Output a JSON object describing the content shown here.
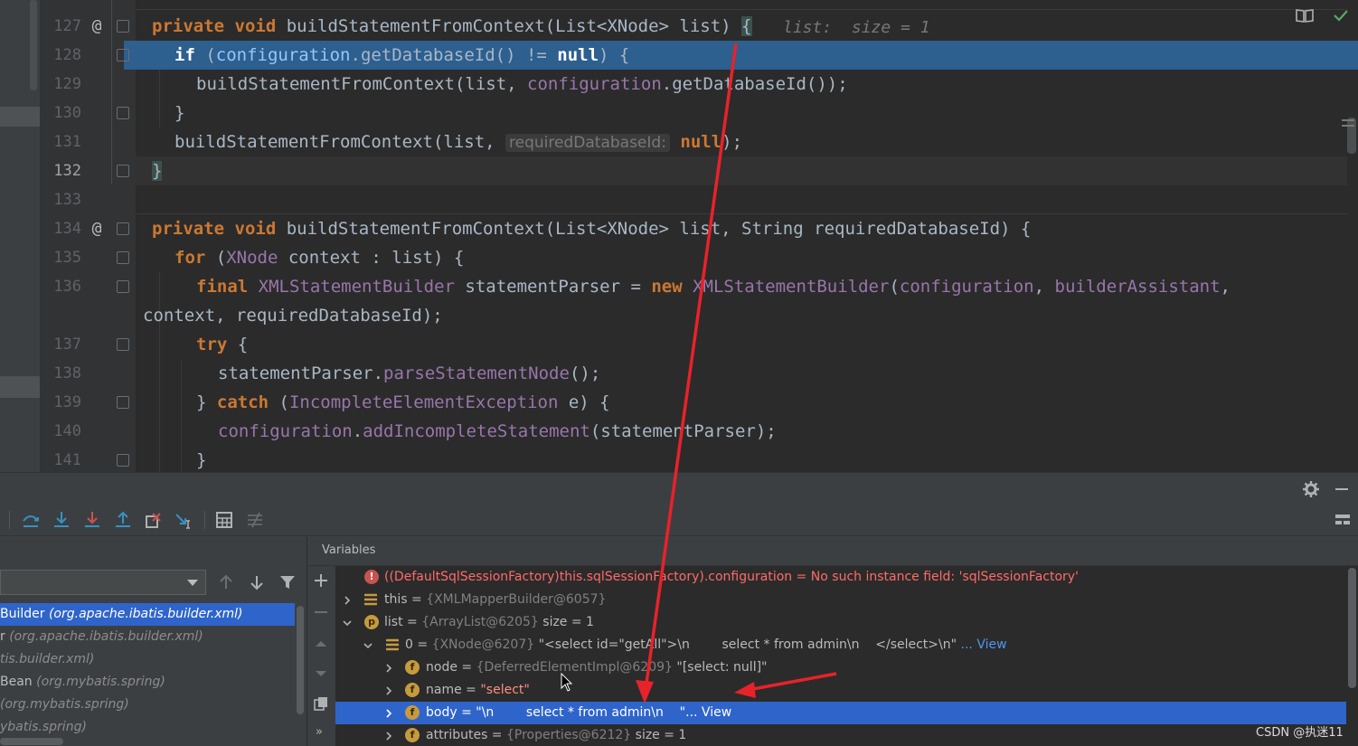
{
  "editor": {
    "inline_debug_value": "list:  size = 1",
    "param_hint": "requiredDatabaseId:",
    "lines": [
      {
        "num": "127",
        "text": "private void buildStatementFromContext(List<XNode> list) {"
      },
      {
        "num": "128",
        "text": "if (configuration.getDatabaseId() != null) {"
      },
      {
        "num": "129",
        "text": "buildStatementFromContext(list, configuration.getDatabaseId());"
      },
      {
        "num": "130",
        "text": "}"
      },
      {
        "num": "131",
        "text": "buildStatementFromContext(list, null);"
      },
      {
        "num": "132",
        "text": "}"
      },
      {
        "num": "133",
        "text": ""
      },
      {
        "num": "134",
        "text": "private void buildStatementFromContext(List<XNode> list, String requiredDatabaseId) {"
      },
      {
        "num": "135",
        "text": "for (XNode context : list) {"
      },
      {
        "num": "136",
        "text": "final XMLStatementBuilder statementParser = new XMLStatementBuilder(configuration, builderAssistant,"
      },
      {
        "num": "",
        "text": "context, requiredDatabaseId);"
      },
      {
        "num": "137",
        "text": "try {"
      },
      {
        "num": "138",
        "text": "statementParser.parseStatementNode();"
      },
      {
        "num": "139",
        "text": "} catch (IncompleteElementException e) {"
      },
      {
        "num": "140",
        "text": "configuration.addIncompleteStatement(statementParser);"
      },
      {
        "num": "141",
        "text": "}"
      }
    ]
  },
  "debug": {
    "variables_title": "Variables",
    "frames": [
      {
        "name": "Builder ",
        "pkg": "(org.apache.ibatis.builder.xml)"
      },
      {
        "name": "r ",
        "pkg": "(org.apache.ibatis.builder.xml)"
      },
      {
        "name": "",
        "pkg": "tis.builder.xml)"
      },
      {
        "name": "Bean ",
        "pkg": "(org.mybatis.spring)"
      },
      {
        "name": " ",
        "pkg": "(org.mybatis.spring)"
      },
      {
        "name": "",
        "pkg": "ybatis.spring)"
      }
    ],
    "variables": [
      {
        "err": "((DefaultSqlSessionFactory)this.sqlSessionFactory).configuration = No such instance field: 'sqlSessionFactory'"
      },
      {
        "name": "this",
        "eq": " = ",
        "type": "{XMLMapperBuilder@6057}",
        "value": ""
      },
      {
        "name": "list",
        "eq": " = ",
        "type": "{ArrayList@6205}",
        "value": "  size = 1"
      },
      {
        "name": "0",
        "eq": " = ",
        "type": "{XNode@6207}",
        "value": " \"<select id=\"getAll\">\\n        select * from admin\\n    </select>\\n\"",
        "link": " ... View"
      },
      {
        "name": "node",
        "eq": " = ",
        "type": "{DeferredElementImpl@6209}",
        "value": " \"[select: null]\""
      },
      {
        "name": "name",
        "eq": " = ",
        "type": "",
        "value": "\"select\""
      },
      {
        "name": "body",
        "eq": " = ",
        "type": "",
        "value": "\"\\n        select * from admin\\n    \"",
        "link": "... View"
      },
      {
        "name": "attributes",
        "eq": " = ",
        "type": "{Properties@6212}",
        "value": "  size = 1"
      }
    ]
  },
  "watermark": "CSDN @执迷11",
  "colors": {
    "annotation_arrow": "#e8222a",
    "selection": "#2f65ca",
    "execution_line": "#2d5f8f"
  }
}
